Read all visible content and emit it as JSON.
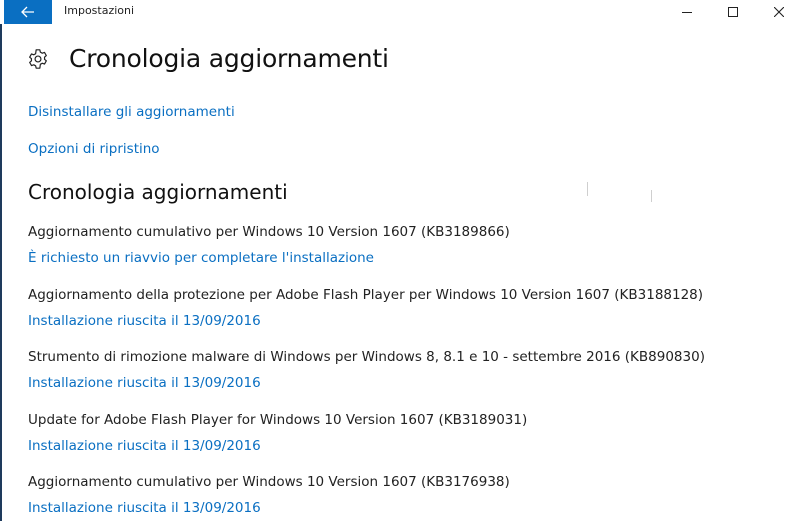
{
  "window": {
    "title": "Impostazioni",
    "accent": "#0a6fc2"
  },
  "header": {
    "title": "Cronologia aggiornamenti",
    "icon": "gear-icon"
  },
  "links": {
    "uninstall": "Disinstallare gli aggiornamenti",
    "recovery": "Opzioni di ripristino"
  },
  "section": {
    "title": "Cronologia aggiornamenti"
  },
  "updates": [
    {
      "name": "Aggiornamento cumulativo per Windows 10 Version 1607 (KB3189866)",
      "status": "È richiesto un riavvio per completare l'installazione"
    },
    {
      "name": "Aggiornamento della protezione per Adobe Flash Player per Windows 10 Version 1607 (KB3188128)",
      "status": "Installazione riuscita il 13/09/2016"
    },
    {
      "name": "Strumento di rimozione malware di Windows per Windows 8, 8.1 e 10 - settembre 2016 (KB890830)",
      "status": "Installazione riuscita il 13/09/2016"
    },
    {
      "name": "Update for Adobe Flash Player for Windows 10 Version 1607 (KB3189031)",
      "status": "Installazione riuscita il 13/09/2016"
    },
    {
      "name": "Aggiornamento cumulativo per Windows 10 Version 1607 (KB3176938)",
      "status": "Installazione riuscita il 13/09/2016"
    }
  ]
}
